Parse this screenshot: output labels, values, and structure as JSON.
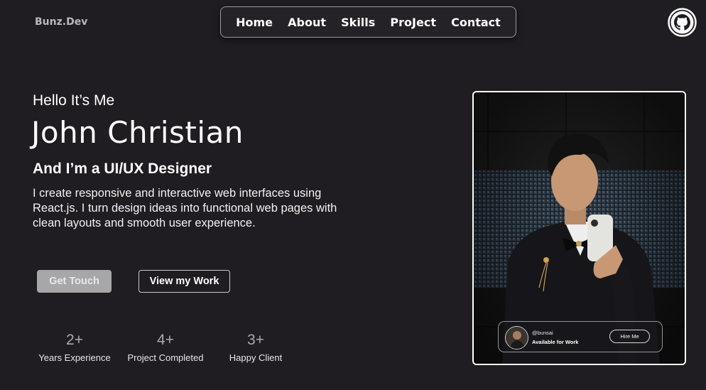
{
  "header": {
    "brand": "Bunz.Dev",
    "nav": [
      "Home",
      "About",
      "Skills",
      "ProJect",
      "Contact"
    ],
    "github_icon": "github-icon"
  },
  "hero": {
    "greeting": "Hello It’s Me",
    "name": "John Christian",
    "role": "And I’m a UI/UX Designer",
    "description": "I create responsive and interactive web interfaces using React.js. I turn design ideas into functional web pages with clean layouts and smooth user experience.",
    "buttons": {
      "primary": "Get Touch",
      "secondary": "View my Work"
    }
  },
  "stats": [
    {
      "value": "2+",
      "label": "Years Experience"
    },
    {
      "value": "4+",
      "label": "Project Completed"
    },
    {
      "value": "3+",
      "label": "Happy Client"
    }
  ],
  "profile_card": {
    "handle": "@bunsai",
    "status": "Available for Work",
    "hire_label": "Hire Me"
  },
  "colors": {
    "background": "#1f1d22",
    "text": "#ffffff",
    "muted": "#a9a9ad",
    "button_primary": "#a7a7a9"
  }
}
